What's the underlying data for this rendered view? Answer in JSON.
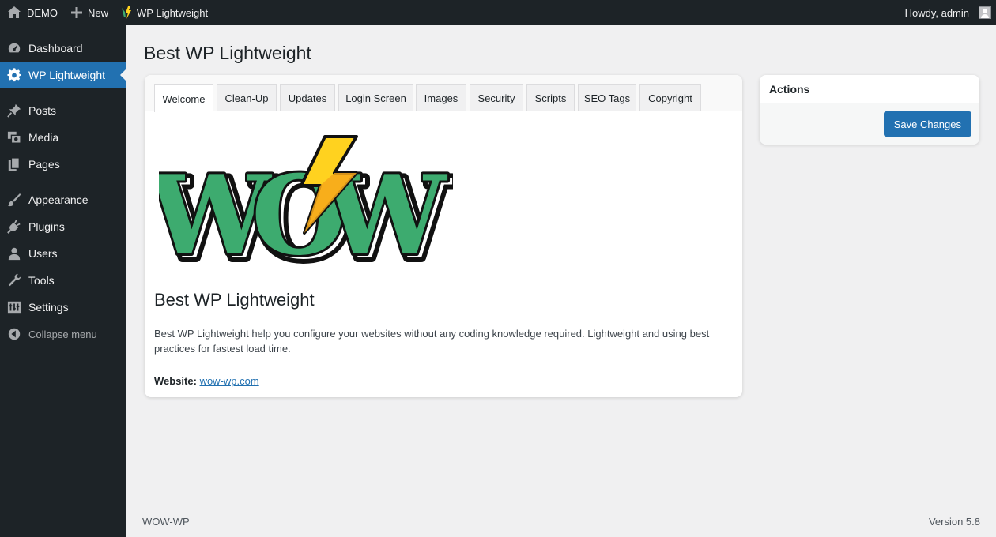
{
  "adminbar": {
    "site_name": "DEMO",
    "new_label": "New",
    "plugin_label": "WP Lightweight",
    "greeting": "Howdy, admin"
  },
  "sidebar": {
    "items": [
      {
        "label": "Dashboard",
        "icon": "dashboard-icon"
      },
      {
        "label": "WP Lightweight",
        "icon": "gear-icon",
        "current": true
      },
      {
        "label": "Posts",
        "icon": "pin-icon"
      },
      {
        "label": "Media",
        "icon": "media-icon"
      },
      {
        "label": "Pages",
        "icon": "pages-icon"
      },
      {
        "label": "Appearance",
        "icon": "brush-icon"
      },
      {
        "label": "Plugins",
        "icon": "plug-icon"
      },
      {
        "label": "Users",
        "icon": "user-icon"
      },
      {
        "label": "Tools",
        "icon": "wrench-icon"
      },
      {
        "label": "Settings",
        "icon": "settings-icon"
      }
    ],
    "collapse_label": "Collapse menu"
  },
  "page": {
    "title": "Best WP Lightweight"
  },
  "tabs": [
    {
      "label": "Welcome",
      "active": true
    },
    {
      "label": "Clean-Up"
    },
    {
      "label": "Updates"
    },
    {
      "label": "Login Screen"
    },
    {
      "label": "Images"
    },
    {
      "label": "Security"
    },
    {
      "label": "Scripts"
    },
    {
      "label": "SEO Tags"
    },
    {
      "label": "Copyright"
    }
  ],
  "welcome": {
    "logo_text": "WOW",
    "heading": "Best WP Lightweight",
    "description": "Best WP Lightweight help you configure your websites without any coding knowledge required. Lightweight and using best practices for fastest load time.",
    "website_label": "Website:",
    "website_link": "wow-wp.com"
  },
  "actions": {
    "title": "Actions",
    "save_label": "Save Changes"
  },
  "footer": {
    "left": "WOW-WP",
    "version": "Version 5.8"
  },
  "colors": {
    "accent": "#2271b1",
    "sidebar_bg": "#1d2327",
    "logo_green": "#3dab6f",
    "bolt_yellow": "#ffd21f"
  }
}
